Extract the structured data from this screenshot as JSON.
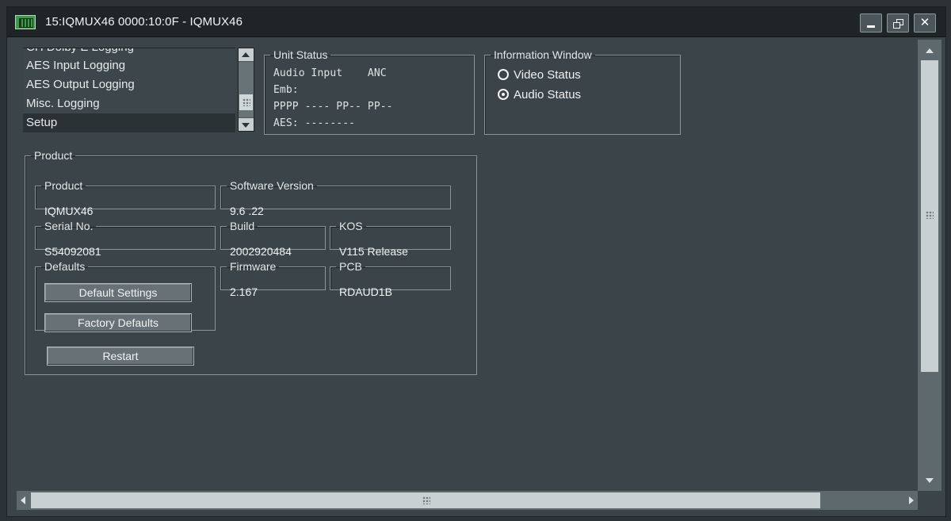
{
  "window": {
    "title": "15:IQMUX46  0000:10:0F  - IQMUX46",
    "icon": "app-icon",
    "controls": [
      "minimize",
      "restore",
      "close"
    ]
  },
  "menu_list": {
    "items": [
      {
        "label": "CH Dolby E Logging",
        "state": "partially-visible"
      },
      {
        "label": "AES Input Logging"
      },
      {
        "label": "AES Output Logging"
      },
      {
        "label": "Misc. Logging"
      },
      {
        "label": "Setup",
        "selected": true
      }
    ]
  },
  "unit_status": {
    "title": "Unit Status",
    "lines": [
      "Audio Input    ANC",
      "Emb:",
      "PPPP ---- PP-- PP--",
      "AES: --------"
    ]
  },
  "information_window": {
    "title": "Information Window",
    "options": [
      {
        "label": "Video Status",
        "selected": false
      },
      {
        "label": "Audio Status",
        "selected": true
      }
    ]
  },
  "product": {
    "title": "Product",
    "product_name": {
      "label": "Product",
      "value": "IQMUX46"
    },
    "software_version": {
      "label": "Software Version",
      "value": "9.6 .22"
    },
    "serial_no": {
      "label": "Serial No.",
      "value": "S54092081"
    },
    "build": {
      "label": "Build",
      "value": "2002920484"
    },
    "kos": {
      "label": "KOS",
      "value": "V115 Release"
    },
    "firmware": {
      "label": "Firmware",
      "value": "2.167"
    },
    "pcb": {
      "label": "PCB",
      "value": "RDAUD1B"
    },
    "defaults": {
      "title": "Defaults",
      "default_settings": "Default Settings",
      "factory_defaults": "Factory Defaults"
    },
    "restart": "Restart"
  },
  "colors": {
    "background": "#3b4549",
    "title_bar": "#1f2527",
    "field_border": "#89969a",
    "button": "#687276",
    "selected_row": "#2a3235"
  }
}
